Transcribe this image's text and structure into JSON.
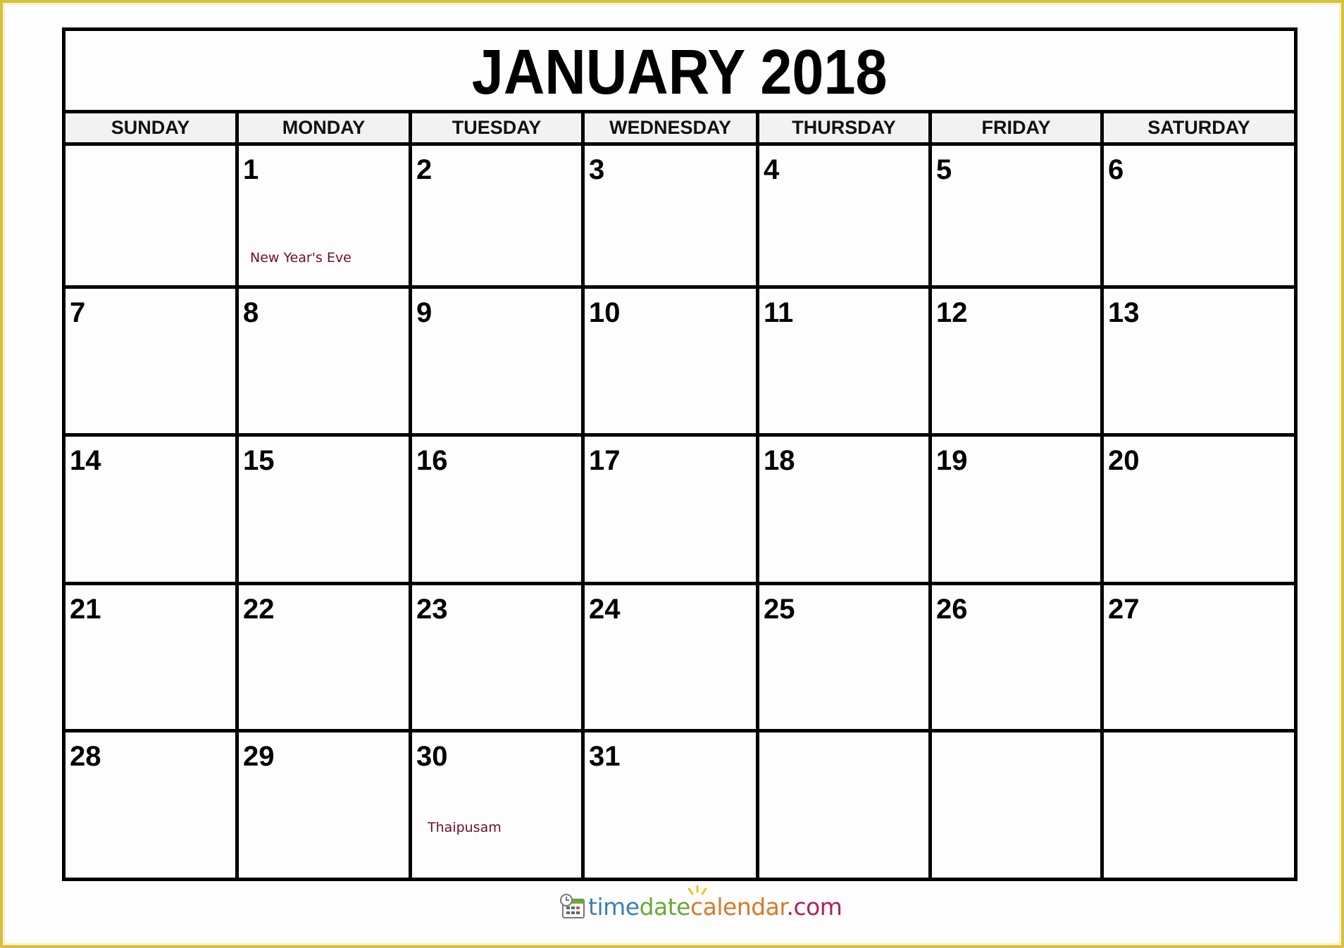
{
  "calendar": {
    "title": "JANUARY 2018",
    "weekdays": [
      "SUNDAY",
      "MONDAY",
      "TUESDAY",
      "WEDNESDAY",
      "THURSDAY",
      "FRIDAY",
      "SATURDAY"
    ],
    "weeks": [
      [
        {
          "day": ""
        },
        {
          "day": "1",
          "event": "New Year's Eve"
        },
        {
          "day": "2"
        },
        {
          "day": "3"
        },
        {
          "day": "4"
        },
        {
          "day": "5"
        },
        {
          "day": "6"
        }
      ],
      [
        {
          "day": "7"
        },
        {
          "day": "8"
        },
        {
          "day": "9"
        },
        {
          "day": "10"
        },
        {
          "day": "11"
        },
        {
          "day": "12"
        },
        {
          "day": "13"
        }
      ],
      [
        {
          "day": "14"
        },
        {
          "day": "15"
        },
        {
          "day": "16"
        },
        {
          "day": "17"
        },
        {
          "day": "18"
        },
        {
          "day": "19"
        },
        {
          "day": "20"
        }
      ],
      [
        {
          "day": "21"
        },
        {
          "day": "22"
        },
        {
          "day": "23"
        },
        {
          "day": "24"
        },
        {
          "day": "25"
        },
        {
          "day": "26"
        },
        {
          "day": "27"
        }
      ],
      [
        {
          "day": "28"
        },
        {
          "day": "29"
        },
        {
          "day": "30",
          "event": "Thaipusam"
        },
        {
          "day": "31"
        },
        {
          "day": ""
        },
        {
          "day": ""
        },
        {
          "day": ""
        }
      ]
    ],
    "event_color": "#6b0f24"
  },
  "footer": {
    "logo_icon": "calendar-clock-icon",
    "logo_parts": [
      {
        "text": "time",
        "color": "#3b80b9"
      },
      {
        "text": "date",
        "color": "#6aa83a"
      },
      {
        "text": "calendar",
        "color": "#d9782b"
      },
      {
        "text": ".com",
        "color": "#b31e5b"
      }
    ]
  },
  "frame_color": "#d9bf3c"
}
